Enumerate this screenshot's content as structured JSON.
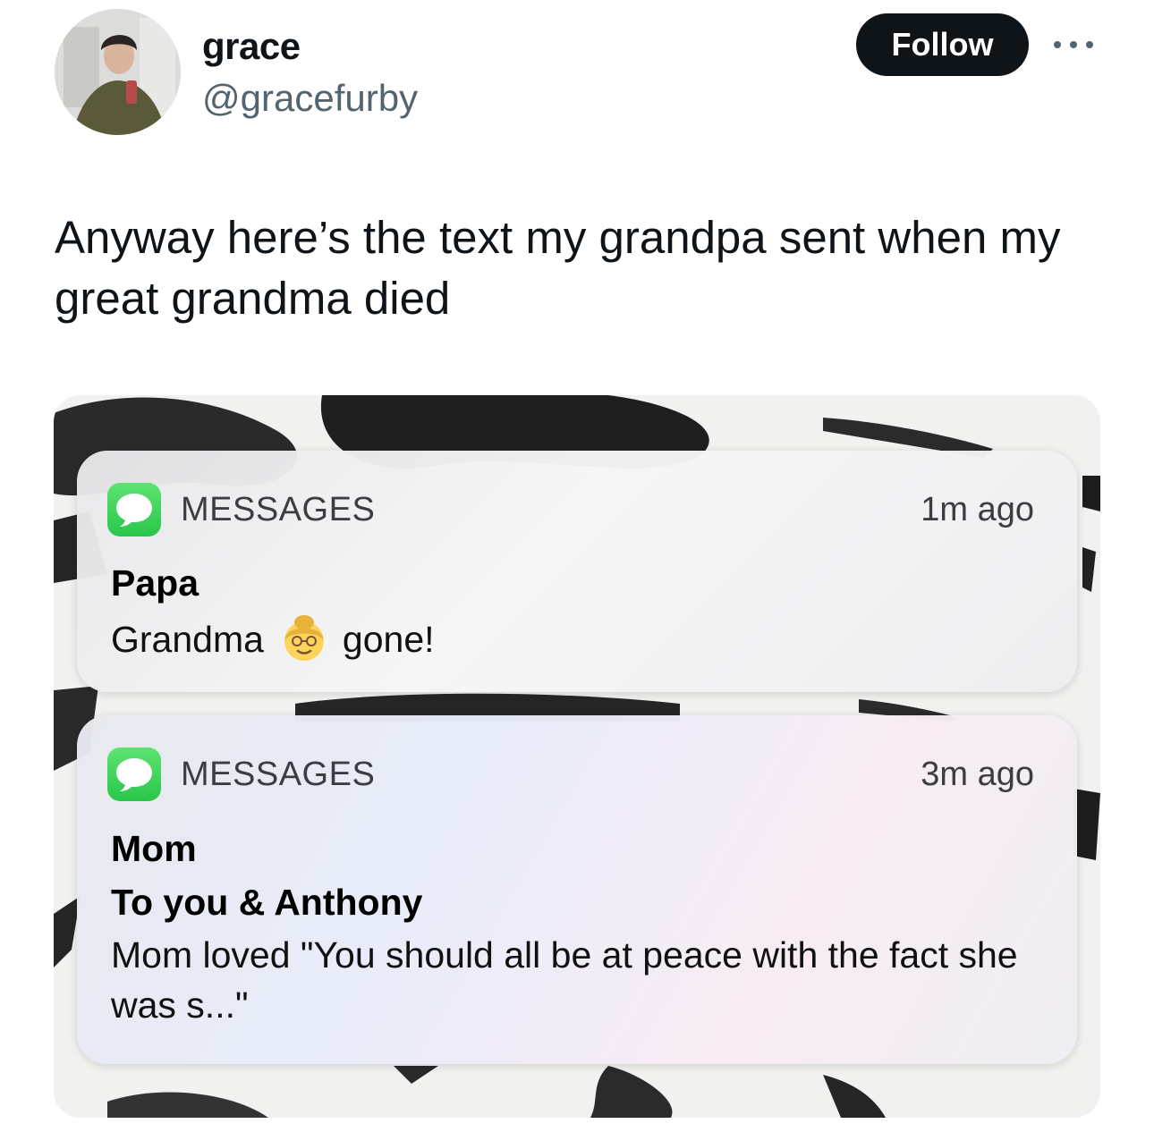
{
  "tweet": {
    "display_name": "grace",
    "handle": "@gracefurby",
    "follow_label": "Follow",
    "text": "Anyway here’s the text my grandpa sent when my great grandma died"
  },
  "notifications": [
    {
      "app": "MESSAGES",
      "time": "1m ago",
      "sender": "Papa",
      "body_before": "Grandma",
      "emoji": "older-woman-emoji",
      "body_after": "gone!"
    },
    {
      "app": "MESSAGES",
      "time": "3m ago",
      "sender": "Mom",
      "subtitle": "To you & Anthony",
      "body": "Mom loved \"You should all be at peace with the fact she was s...\""
    }
  ],
  "colors": {
    "follow_bg": "#0f1419",
    "handle": "#536471",
    "messages_icon": "#34c759"
  }
}
